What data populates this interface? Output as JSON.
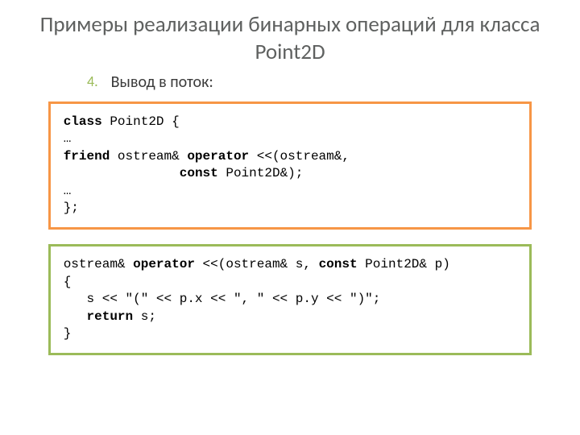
{
  "title": "Примеры реализации бинарных операций для класса Point2D",
  "list_number": "4.",
  "subtitle": "Вывод в поток:",
  "code1": {
    "l1k": "class",
    "l1r": " Point2D {",
    "l2": "…",
    "l3a": "friend",
    "l3b": " ostream& ",
    "l3c": "operator",
    "l3d": " <<(ostream&,",
    "l4a": "               ",
    "l4b": "const",
    "l4c": " Point2D&);",
    "l5": "…",
    "l6": "};"
  },
  "code2": {
    "l1a": "ostream& ",
    "l1b": "operator",
    "l1c": " <<(ostream& s, ",
    "l1d": "const",
    "l1e": " Point2D& p)",
    "l2": "{",
    "l3": "   s << ″(″ << p.x << ″, ″ << p.y << ″)″;",
    "l4a": "   ",
    "l4b": "return",
    "l4c": " s;",
    "l5": "}"
  }
}
